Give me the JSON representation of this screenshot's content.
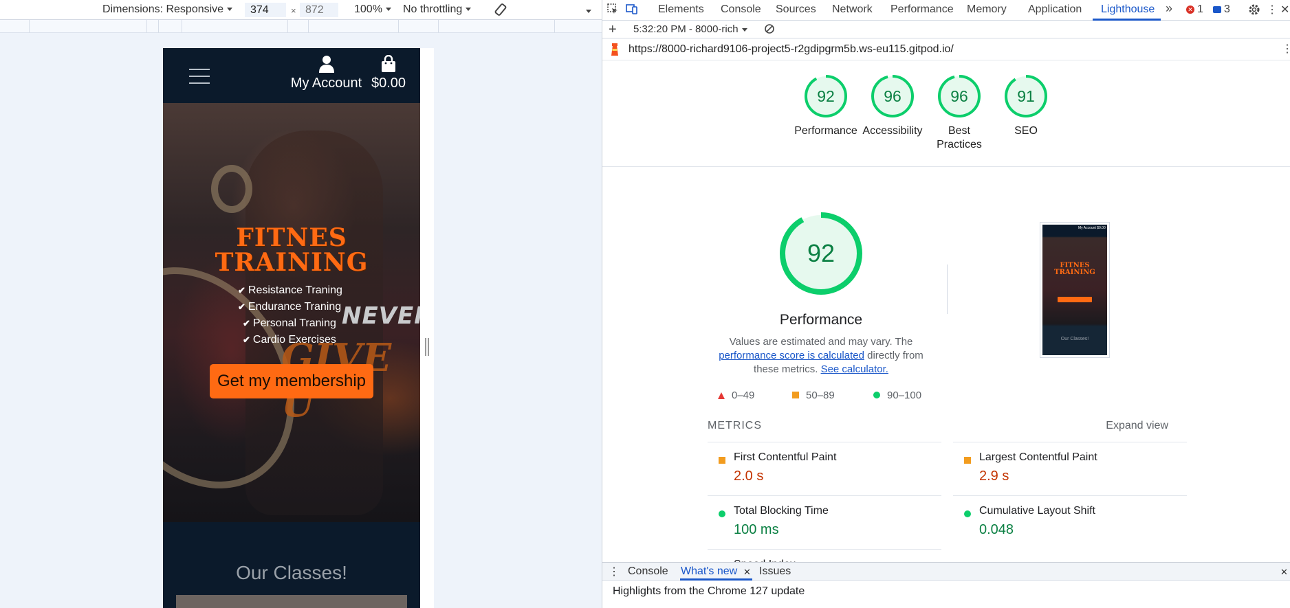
{
  "device_toolbar": {
    "dimensions_label": "Dimensions: Responsive",
    "width_value": "374",
    "height_placeholder": "872",
    "times": "×",
    "zoom": "100%",
    "throttling": "No throttling"
  },
  "site": {
    "account_label": "My Account",
    "basket_total": "$0.00",
    "hero_title_line1": "FITNES",
    "hero_title_line2": "TRAINING",
    "features": [
      "Resistance Traning",
      "Endurance Traning",
      "Personal Traning",
      "Cardio Exercises"
    ],
    "never_text": "NEVER",
    "giveup_text": "GIVE U",
    "cta_label": "Get my membership",
    "classes_heading": "Our Classes!"
  },
  "devtools": {
    "tabs": [
      "Elements",
      "Console",
      "Sources",
      "Network",
      "Performance",
      "Memory",
      "Application",
      "Lighthouse"
    ],
    "active_tab": "Lighthouse",
    "more_tabs": "»",
    "error_count": "1",
    "message_count": "3",
    "report_selector": "5:32:20 PM - 8000-rich",
    "url": "https://8000-richard9106-project5-r2gdipgrm5b.ws-eu115.gitpod.io/"
  },
  "scores": [
    {
      "label": "Performance",
      "value": 92
    },
    {
      "label": "Accessibility",
      "value": 96
    },
    {
      "label": "Best Practices",
      "value": 96
    },
    {
      "label": "SEO",
      "value": 91
    }
  ],
  "performance": {
    "score": 92,
    "title": "Performance",
    "desc_before": "Values are estimated and may vary. The ",
    "desc_link": "performance score is calculated",
    "desc_after": " directly from these metrics. ",
    "calc_link": "See calculator.",
    "thumb_title": "FITNES TRAINING",
    "thumb_classes": "Our Classes!",
    "thumb_account": "My Account  $0.00"
  },
  "legend": {
    "fail": "0–49",
    "average": "50–89",
    "pass": "90–100"
  },
  "metrics": {
    "heading": "METRICS",
    "expand_label": "Expand view",
    "items": [
      {
        "name": "First Contentful Paint",
        "value": "2.0 s",
        "status": "average"
      },
      {
        "name": "Largest Contentful Paint",
        "value": "2.9 s",
        "status": "average"
      },
      {
        "name": "Total Blocking Time",
        "value": "100 ms",
        "status": "pass"
      },
      {
        "name": "Cumulative Layout Shift",
        "value": "0.048",
        "status": "pass"
      },
      {
        "name": "Speed Index",
        "value": "",
        "status": "pass"
      }
    ]
  },
  "drawer": {
    "tabs": [
      "Console",
      "What's new",
      "Issues"
    ],
    "active_tab": "What's new",
    "message": "Highlights from the Chrome 127 update"
  },
  "colors": {
    "accent_orange": "#ff6a13",
    "navy": "#0b1a2b",
    "pass_green": "#0cce6b",
    "pass_text": "#0b8043",
    "average_orange": "#f29c1f",
    "average_text": "#c33300",
    "fail_red": "#e53935",
    "devtools_blue": "#1a57c9"
  }
}
